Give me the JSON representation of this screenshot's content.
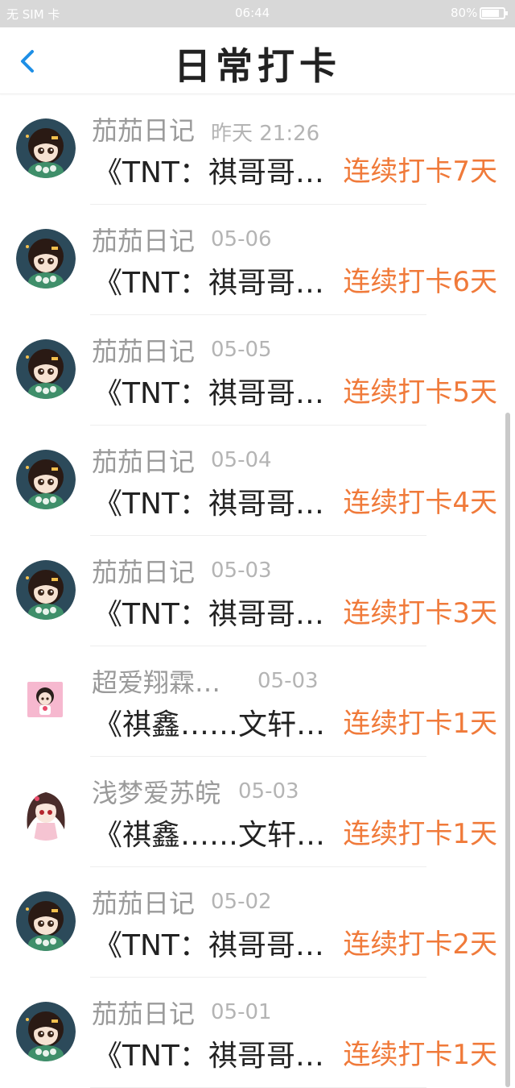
{
  "status_bar": {
    "left_text": "无 SIM 卡",
    "time": "06:44",
    "battery": "80%",
    "battery_level": 0.8
  },
  "header": {
    "title": "日常打卡",
    "back_icon": "chevron-left-icon"
  },
  "colors": {
    "accent": "#1e8fe6",
    "streak": "#f07a3a",
    "name": "#9a9a9a",
    "title": "#222222"
  },
  "entries": [
    {
      "user": "茄茄日记",
      "time": "昨天 21:26",
      "title": "《TNT：祺哥哥…",
      "streak": "连续打卡7天",
      "avatar": "round-avatar"
    },
    {
      "user": "茄茄日记",
      "time": "05-06",
      "title": "《TNT：祺哥哥…",
      "streak": "连续打卡6天",
      "avatar": "round-avatar"
    },
    {
      "user": "茄茄日记",
      "time": "05-05",
      "title": "《TNT：祺哥哥…",
      "streak": "连续打卡5天",
      "avatar": "round-avatar"
    },
    {
      "user": "茄茄日记",
      "time": "05-04",
      "title": "《TNT：祺哥哥…",
      "streak": "连续打卡4天",
      "avatar": "round-avatar"
    },
    {
      "user": "茄茄日记",
      "time": "05-03",
      "title": "《TNT：祺哥哥…",
      "streak": "连续打卡3天",
      "avatar": "round-avatar"
    },
    {
      "user": "超爱翔霖…",
      "time": "05-03",
      "title": "《祺鑫……文轩…",
      "streak": "连续打卡1天",
      "avatar": "square-avatar"
    },
    {
      "user": "浅梦爱苏皖",
      "time": "05-03",
      "title": "《祺鑫……文轩…",
      "streak": "连续打卡1天",
      "avatar": "anime-avatar"
    },
    {
      "user": "茄茄日记",
      "time": "05-02",
      "title": "《TNT：祺哥哥…",
      "streak": "连续打卡2天",
      "avatar": "round-avatar"
    },
    {
      "user": "茄茄日记",
      "time": "05-01",
      "title": "《TNT：祺哥哥…",
      "streak": "连续打卡1天",
      "avatar": "round-avatar"
    }
  ]
}
